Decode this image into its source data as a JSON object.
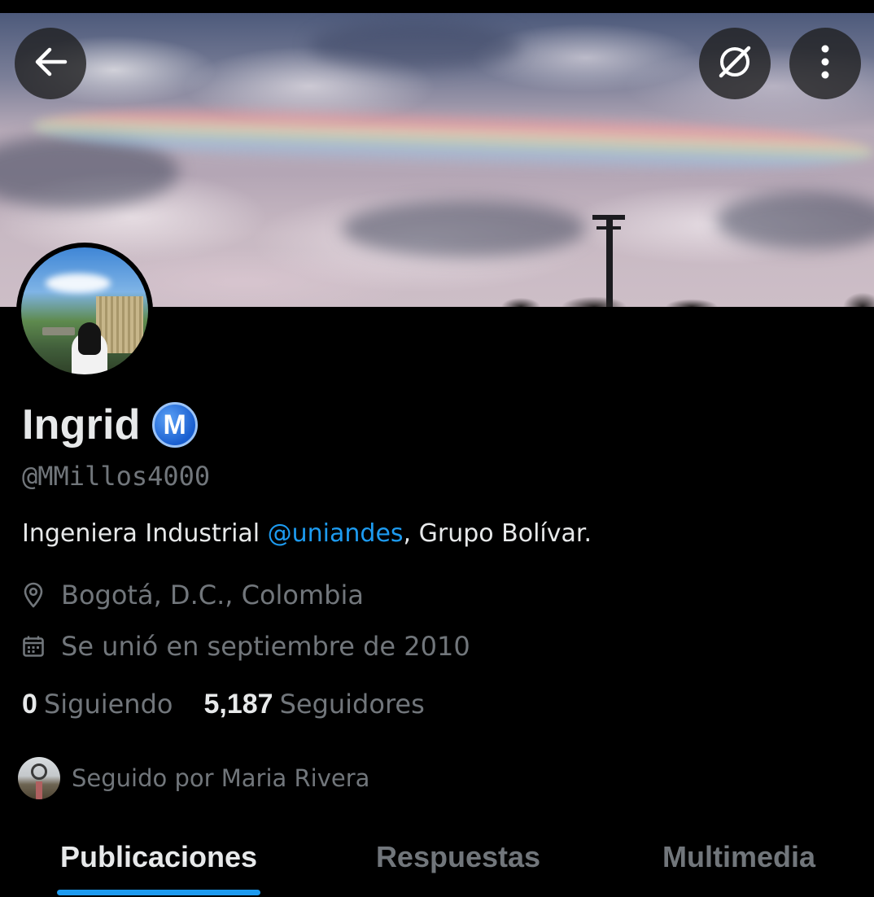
{
  "header": {
    "back_icon": "arrow-left-icon",
    "grok_icon": "grok-icon",
    "more_icon": "more-vertical-icon"
  },
  "profile": {
    "name": "Ingrid",
    "badge_letter": "M",
    "handle": "@MMillos4000",
    "bio": {
      "prefix": "Ingeniera Industrial ",
      "mention": "@uniandes",
      "suffix": ", Grupo Bolívar."
    },
    "location": "Bogotá, D.C., Colombia",
    "joined": "Se unió en septiembre de 2010",
    "following_count": "0",
    "following_label": "Siguiendo",
    "followers_count": "5,187",
    "followers_label": "Seguidores",
    "followed_by": "Seguido por Maria Rivera"
  },
  "tabs": [
    {
      "label": "Publicaciones",
      "active": true
    },
    {
      "label": "Respuestas",
      "active": false
    },
    {
      "label": "Multimedia",
      "active": false
    }
  ],
  "colors": {
    "background": "#000000",
    "text_primary": "#e7e9ea",
    "text_secondary": "#71767b",
    "accent": "#1d9bf0"
  }
}
